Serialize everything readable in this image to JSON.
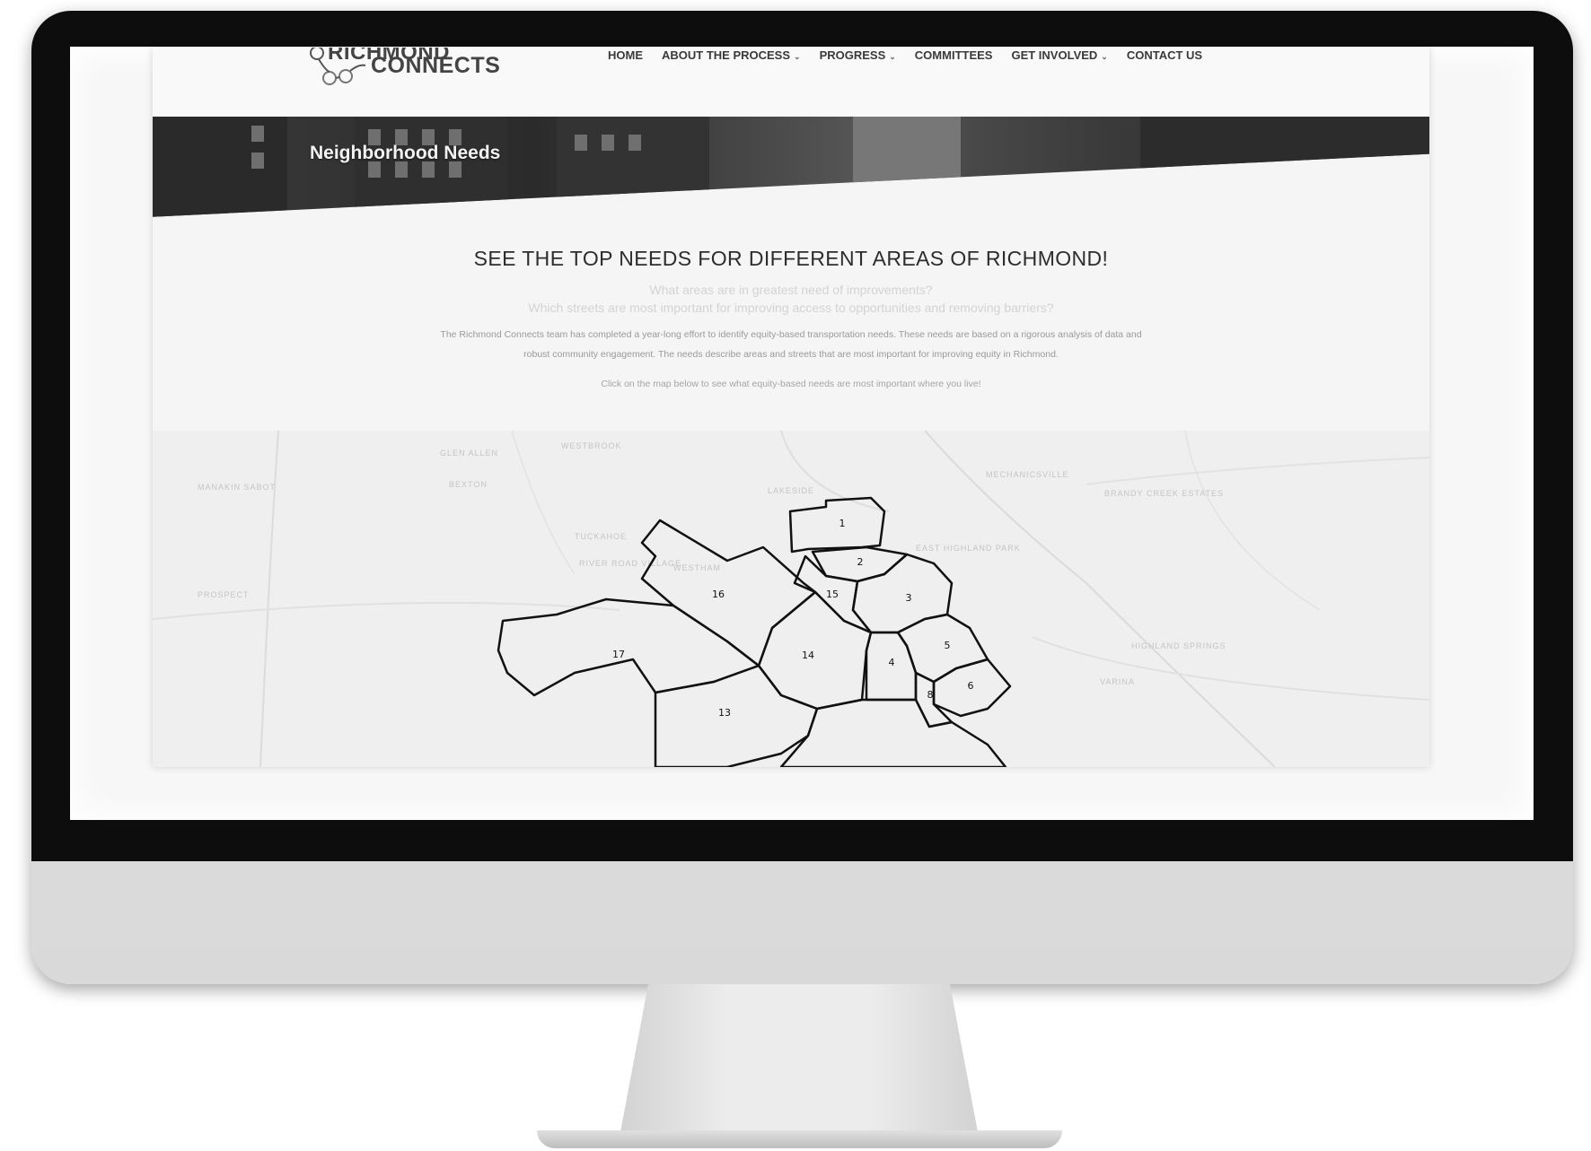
{
  "site": {
    "logo_line1": "RICHMOND",
    "logo_line2": "CONNECTS",
    "nav": [
      {
        "label": "HOME",
        "dropdown": false
      },
      {
        "label": "ABOUT THE PROCESS",
        "dropdown": true
      },
      {
        "label": "PROGRESS",
        "dropdown": true
      },
      {
        "label": "COMMITTEES",
        "dropdown": false
      },
      {
        "label": "GET INVOLVED",
        "dropdown": true
      },
      {
        "label": "CONTACT US",
        "dropdown": false
      }
    ],
    "hero_title": "Neighborhood Needs",
    "heading": "SEE THE TOP NEEDS FOR DIFFERENT AREAS OF RICHMOND!",
    "question_1": "What areas are in greatest need of improvements?",
    "question_2": "Which streets are most important for improving access to opportunities and removing barriers?",
    "paragraph_line1": "The Richmond Connects team has completed a year-long effort to identify equity-based transportation needs. These needs are based on a rigorous analysis of data and",
    "paragraph_line2": "robust community engagement. The needs describe areas and streets that are most important for improving equity in Richmond.",
    "cta": "Click on the map below to see what equity-based needs are most important where you live!"
  },
  "map": {
    "regions": [
      {
        "id": "1",
        "label": "1"
      },
      {
        "id": "2",
        "label": "2"
      },
      {
        "id": "3",
        "label": "3"
      },
      {
        "id": "4",
        "label": "4"
      },
      {
        "id": "5",
        "label": "5"
      },
      {
        "id": "6",
        "label": "6"
      },
      {
        "id": "8",
        "label": "8"
      },
      {
        "id": "13",
        "label": "13"
      },
      {
        "id": "14",
        "label": "14"
      },
      {
        "id": "15",
        "label": "15"
      },
      {
        "id": "16",
        "label": "16"
      },
      {
        "id": "17",
        "label": "17"
      }
    ],
    "base_labels": [
      "MANAKIN SABOT",
      "BEXTON",
      "WESTBROOK",
      "LAKESIDE",
      "HIGHLAND SPRINGS",
      "MECHANICSVILLE",
      "BRANDY CREEK ESTATES",
      "TUCKAHOE",
      "RIVER ROAD VILLAGE",
      "WESTHAM",
      "PROSPECT",
      "EAST HIGHLAND PARK",
      "VARINA",
      "GLEN ALLEN"
    ]
  }
}
